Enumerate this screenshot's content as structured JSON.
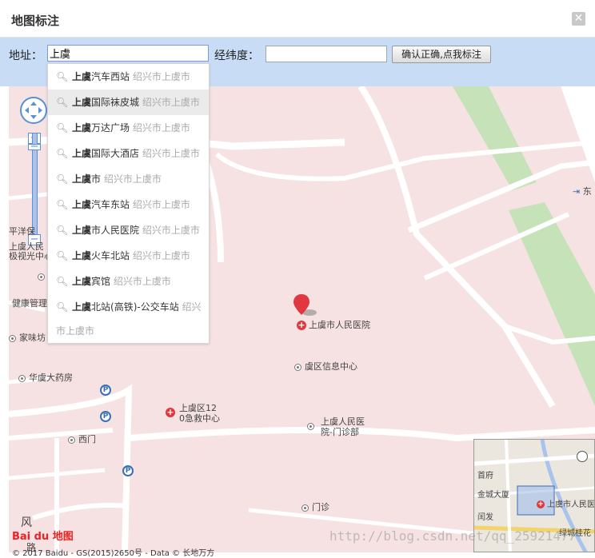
{
  "dialog": {
    "title": "地图标注",
    "close_glyph": "✕"
  },
  "toolbar": {
    "address_label": "地址：",
    "address_value": "上虞",
    "latlng_label": "经纬度：",
    "latlng_value": "",
    "confirm_label": "确认正确,点我标注"
  },
  "suggestions": [
    {
      "bold": "上虞",
      "rest": "汽车西站",
      "city": "绍兴市上虞市"
    },
    {
      "bold": "上虞",
      "rest": "国际袜皮城",
      "city": "绍兴市上虞市"
    },
    {
      "bold": "上虞",
      "rest": "万达广场",
      "city": "绍兴市上虞市"
    },
    {
      "bold": "上虞",
      "rest": "国际大酒店",
      "city": "绍兴市上虞市"
    },
    {
      "bold": "上虞",
      "rest": "市",
      "city": "绍兴市上虞市"
    },
    {
      "bold": "上虞",
      "rest": "汽车东站",
      "city": "绍兴市上虞市"
    },
    {
      "bold": "上虞",
      "rest": "市人民医院",
      "city": "绍兴市上虞市"
    },
    {
      "bold": "上虞",
      "rest": "火车北站",
      "city": "绍兴市上虞市"
    },
    {
      "bold": "上虞",
      "rest": "宾馆",
      "city": "绍兴市上虞市"
    },
    {
      "bold": "上虞",
      "rest": "北站(高铁)-公交车站",
      "city": "绍兴"
    }
  ],
  "suggestion_overflow": "市上虞市",
  "map": {
    "pois": {
      "hospital_main": "上虞市人民医院",
      "info_center": "虞区信息中心",
      "emergency_1": "上虞区12",
      "emergency_2": "0急救中心",
      "outpatient_1": "上虞人民医",
      "outpatient_2": "院-门诊部",
      "gate": "门诊",
      "west_gate": "西门",
      "pharmacy": "华虞大药房",
      "health": "健康管理",
      "jiawei": "家味坊",
      "left1": "平洋保",
      "left2": "上虞人民",
      "left3": "极视光中心",
      "east": "东",
      "feng": "风",
      "lu": "路"
    },
    "overview": {
      "p1": "首府",
      "p2": "金城大厦",
      "p3": "上虞市人民医",
      "p4": "闰发",
      "p5": "绿城桂花"
    },
    "logo": "Bai du 地图",
    "copyright": "© 2017 Baidu - GS(2015)2650号 - Data © 长地万方",
    "watermark": "http://blog.csdn.net/qq_25921477"
  },
  "colors": {
    "map_bg": "#f6e2e2",
    "park": "#c6e2b9",
    "road": "#ffffff",
    "accent": "#5b8fd6"
  }
}
